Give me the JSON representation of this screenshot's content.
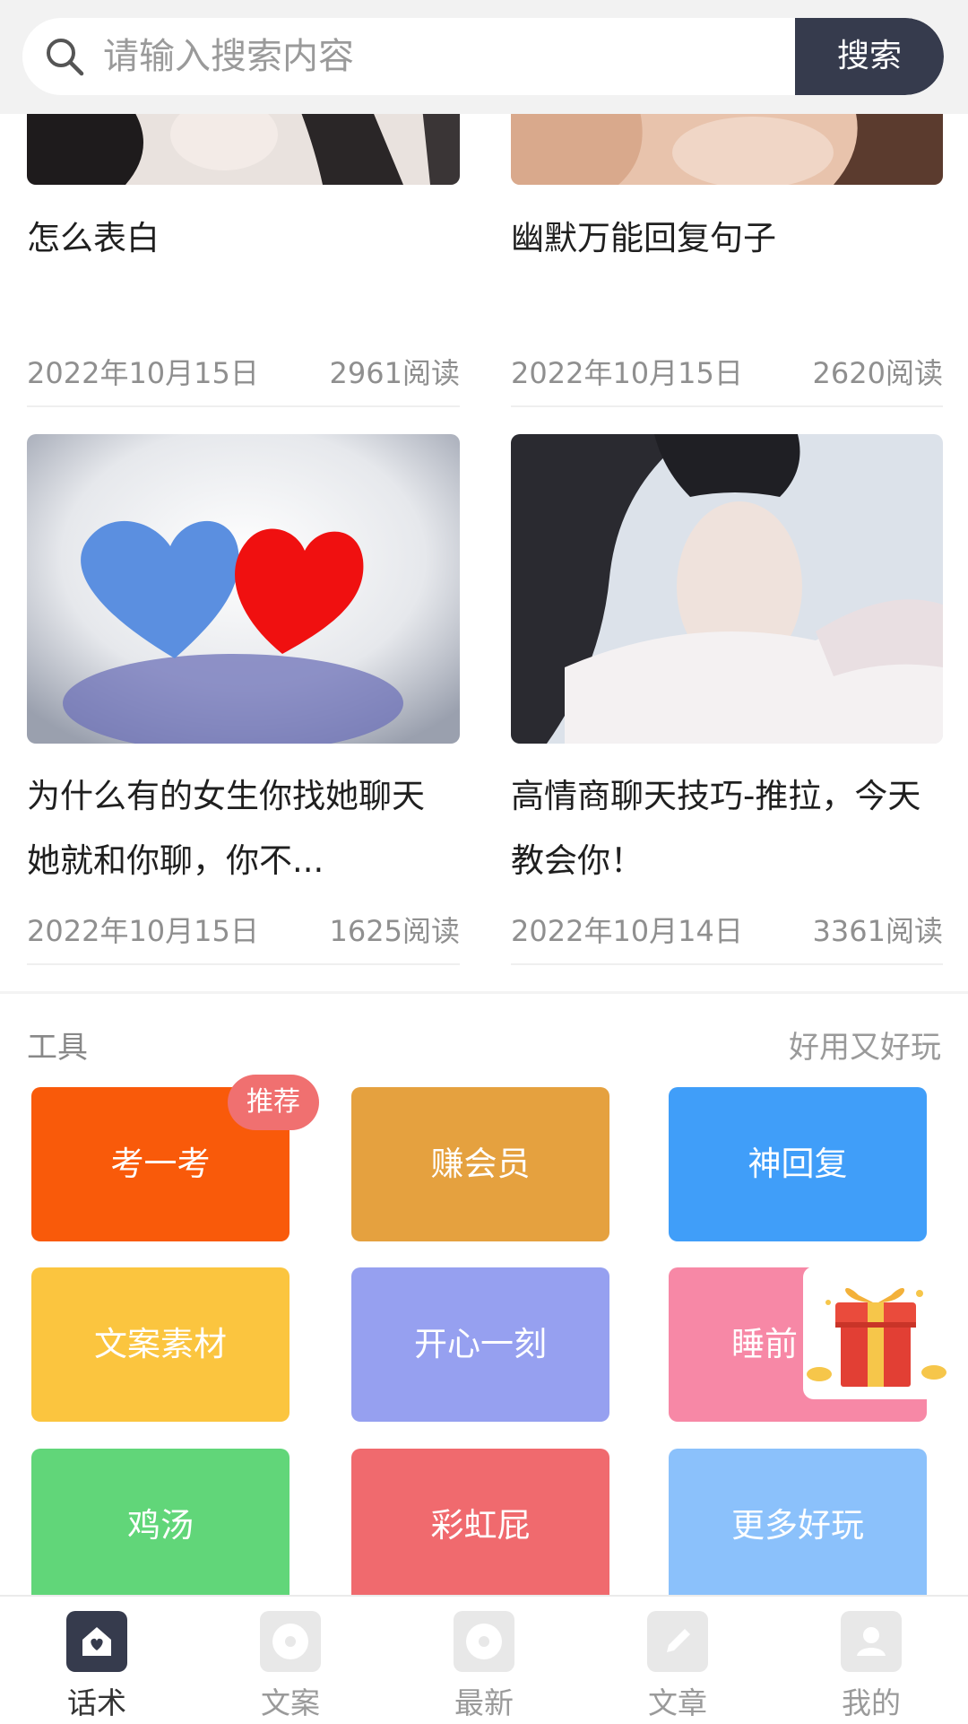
{
  "search": {
    "placeholder": "请输入搜索内容",
    "button_label": "搜索"
  },
  "articles": [
    {
      "title": "怎么表白",
      "date": "2022年10月15日",
      "reads": "2961阅读"
    },
    {
      "title": "幽默万能回复句子",
      "date": "2022年10月15日",
      "reads": "2620阅读"
    },
    {
      "title": "为什么有的女生你找她聊天她就和你聊，你不...",
      "date": "2022年10月15日",
      "reads": "1625阅读"
    },
    {
      "title": "高情商聊天技巧-推拉，今天教会你！",
      "date": "2022年10月14日",
      "reads": "3361阅读"
    }
  ],
  "tools": {
    "title": "工具",
    "subtitle": "好用又好玩",
    "badge": "推荐",
    "items": [
      {
        "label": "考一考",
        "color": "#f95a0a"
      },
      {
        "label": "赚会员",
        "color": "#e5a13f"
      },
      {
        "label": "神回复",
        "color": "#409ef9"
      },
      {
        "label": "文案素材",
        "color": "#fbc53f"
      },
      {
        "label": "开心一刻",
        "color": "#96a0f0"
      },
      {
        "label": "睡前",
        "color": "#f788a6"
      },
      {
        "label": "鸡汤",
        "color": "#61d679"
      },
      {
        "label": "彩虹屁",
        "color": "#f06a6e"
      },
      {
        "label": "更多好玩",
        "color": "#8bc1fb"
      }
    ]
  },
  "bottom_nav": [
    {
      "label": "话术",
      "icon": "home-icon",
      "active": true
    },
    {
      "label": "文案",
      "icon": "disc-icon",
      "active": false
    },
    {
      "label": "最新",
      "icon": "disc-icon",
      "active": false
    },
    {
      "label": "文章",
      "icon": "pencil-icon",
      "active": false
    },
    {
      "label": "我的",
      "icon": "user-icon",
      "active": false
    }
  ]
}
